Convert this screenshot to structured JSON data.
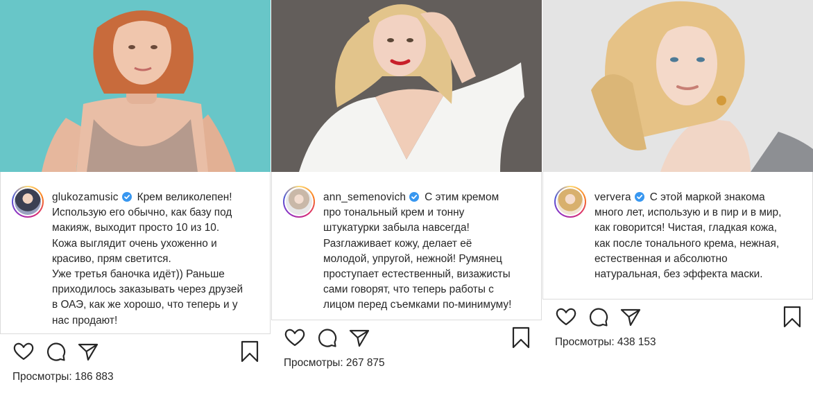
{
  "posts": [
    {
      "username": "glukozamusic",
      "caption_lines": [
        "Крем великолепен!",
        "Использую его обычно, как базу под",
        "макияж, выходит просто 10 из 10.",
        "Кожа выглядит очень ухоженно и",
        "красиво, прям светится.",
        "Уже третья баночка идёт)) Раньше",
        "приходилось заказывать через друзей",
        "в ОАЭ, как же хорошо, что теперь и у",
        "нас продают!"
      ],
      "views_label": "Просмотры:",
      "views": "186 883"
    },
    {
      "username": "ann_semenovich",
      "caption_lines": [
        "С этим кремом",
        "про тональный крем и тонну",
        "штукатурки забыла навсегда!",
        "Разглаживает кожу, делает её",
        "молодой, упругой, нежной! Румянец",
        "проступает естественный, визажисты",
        "сами говорят, что теперь работы с",
        "лицом перед съемками по-минимуму!"
      ],
      "views_label": "Просмотры:",
      "views": "267 875"
    },
    {
      "username": "ververa",
      "caption_lines": [
        "С этой маркой знакома",
        "много лет, использую и в пир и в мир,",
        "как говорится! Чистая, гладкая кожа,",
        "как после тонального крема, нежная,",
        "естественная и абсолютно",
        "натуральная, без эффекта маски."
      ],
      "views_label": "Просмотры:",
      "views": "438 153"
    }
  ],
  "icons": [
    "heart-icon",
    "comment-icon",
    "share-icon",
    "bookmark-icon",
    "verified-badge-icon"
  ],
  "colors": {
    "verified": "#3897f0",
    "text": "#262626",
    "border": "#dbdbdb",
    "photo1_bg": "#5cc1c4",
    "photo2_bg": "#6f6a66",
    "photo3_bg": "#e4e4e4"
  }
}
